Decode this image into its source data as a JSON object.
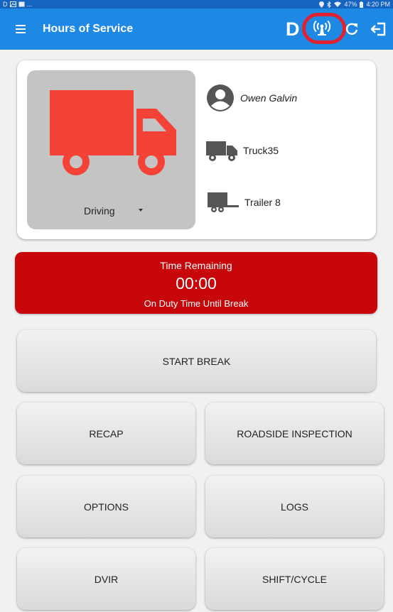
{
  "status_bar": {
    "left_letter": "D",
    "left_extra": "...",
    "battery": "47%",
    "time": "4:20 PM"
  },
  "app_bar": {
    "title": "Hours of Service",
    "mode_letter": "D"
  },
  "status_card": {
    "duty_status": "Driving",
    "driver_name": "Owen Galvin",
    "truck": "Truck35",
    "trailer": "Trailer 8"
  },
  "time_remaining": {
    "label": "Time Remaining",
    "value": "00:00",
    "subtitle": "On Duty Time Until Break"
  },
  "buttons": {
    "start_break": "START BREAK",
    "recap": "RECAP",
    "roadside_inspection": "ROADSIDE INSPECTION",
    "options": "OPTIONS",
    "logs": "LOGS",
    "dvir": "DVIR",
    "shift_cycle": "SHIFT/CYCLE"
  },
  "colors": {
    "app_bar": "#1e88e5",
    "status_bar": "#1565c0",
    "alert_red": "#c8070b",
    "truck_red": "#f44336",
    "highlight_ring": "#e0212f"
  },
  "icons": {
    "menu": "menu-icon",
    "signal": "signal-broadcast-icon",
    "refresh": "refresh-icon",
    "logout": "logout-icon",
    "driver": "account-circle-icon",
    "truck": "truck-icon",
    "trailer": "trailer-icon"
  }
}
